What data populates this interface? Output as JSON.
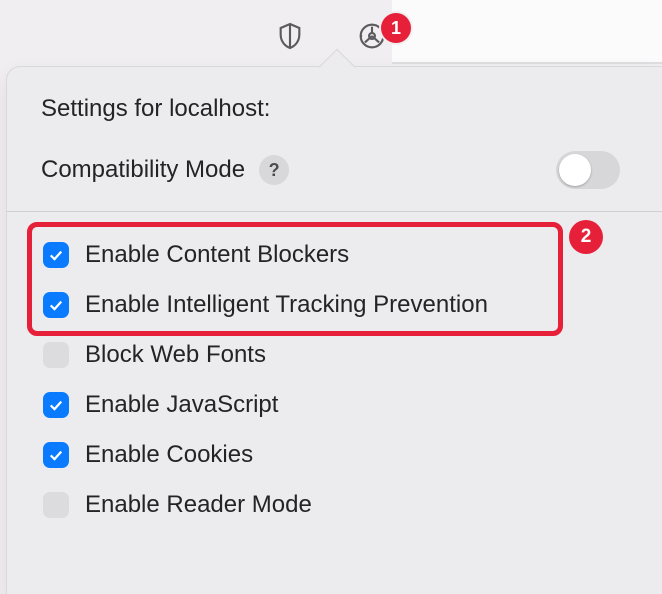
{
  "annotations": {
    "badge1": "1",
    "badge2": "2"
  },
  "popover": {
    "title": "Settings for localhost:",
    "compat": {
      "label": "Compatibility Mode",
      "help": "?",
      "on": false
    },
    "options": [
      {
        "label": "Enable Content Blockers",
        "checked": true
      },
      {
        "label": "Enable Intelligent Tracking Prevention",
        "checked": true
      },
      {
        "label": "Block Web Fonts",
        "checked": false
      },
      {
        "label": "Enable JavaScript",
        "checked": true
      },
      {
        "label": "Enable Cookies",
        "checked": true
      },
      {
        "label": "Enable Reader Mode",
        "checked": false
      }
    ]
  }
}
